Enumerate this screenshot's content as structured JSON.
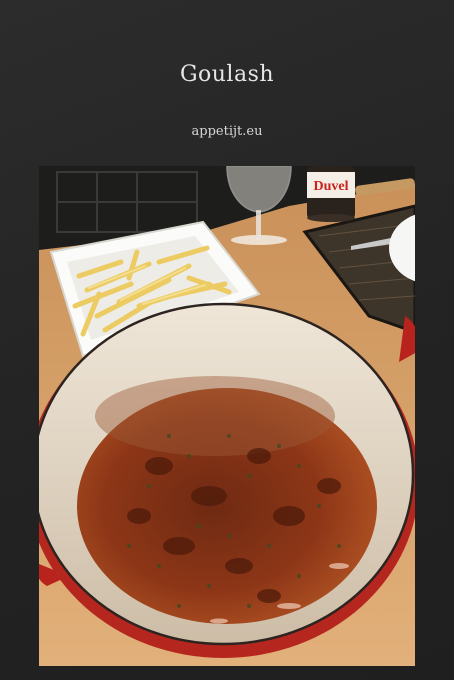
{
  "page": {
    "title": "Goulash",
    "subtitle": "appetijt.eu"
  },
  "photo": {
    "subject": "pot-of-goulash",
    "bottle_label": "Duvel",
    "colors": {
      "table": "#dca66a",
      "pot_red": "#c42a22",
      "enamel": "#e9dccb",
      "stew": "#8a3516",
      "fries": "#f1d274",
      "dish": "#f7f7f5"
    }
  }
}
